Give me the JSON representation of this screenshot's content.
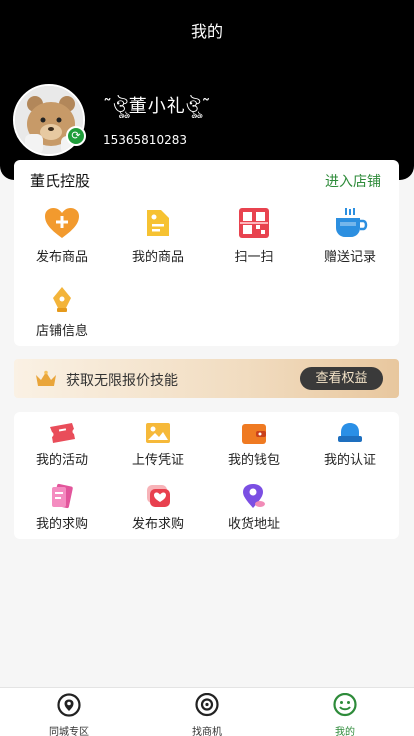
{
  "header": {
    "title": "我的"
  },
  "profile": {
    "name": "˜ঔৣ董小礼ঔৣ˜",
    "phone": "15365810283"
  },
  "shop": {
    "name": "董氏控股",
    "enter_label": "进入店铺",
    "items": [
      {
        "label": "发布商品",
        "icon": "heart-plus-icon"
      },
      {
        "label": "我的商品",
        "icon": "price-tag-icon"
      },
      {
        "label": "扫一扫",
        "icon": "qr-scan-icon"
      },
      {
        "label": "赠送记录",
        "icon": "coffee-cup-icon"
      },
      {
        "label": "店铺信息",
        "icon": "pen-nib-icon"
      }
    ]
  },
  "promo": {
    "text": "获取无限报价技能",
    "button": "查看权益"
  },
  "tools": {
    "items": [
      {
        "label": "我的活动",
        "icon": "ticket-icon"
      },
      {
        "label": "上传凭证",
        "icon": "image-icon"
      },
      {
        "label": "我的钱包",
        "icon": "wallet-icon"
      },
      {
        "label": "我的认证",
        "icon": "badge-check-icon"
      },
      {
        "label": "我的求购",
        "icon": "ticket-list-icon"
      },
      {
        "label": "发布求购",
        "icon": "heart-chat-icon"
      },
      {
        "label": "收货地址",
        "icon": "location-pin-icon"
      }
    ]
  },
  "tabbar": {
    "tabs": [
      {
        "label": "同城专区",
        "icon": "location-circle-icon"
      },
      {
        "label": "找商机",
        "icon": "chat-bubble-icon"
      },
      {
        "label": "我的",
        "icon": "smile-icon",
        "active": true
      }
    ]
  },
  "colors": {
    "accent": "#2e8b3a",
    "header_bg": "#000000"
  }
}
